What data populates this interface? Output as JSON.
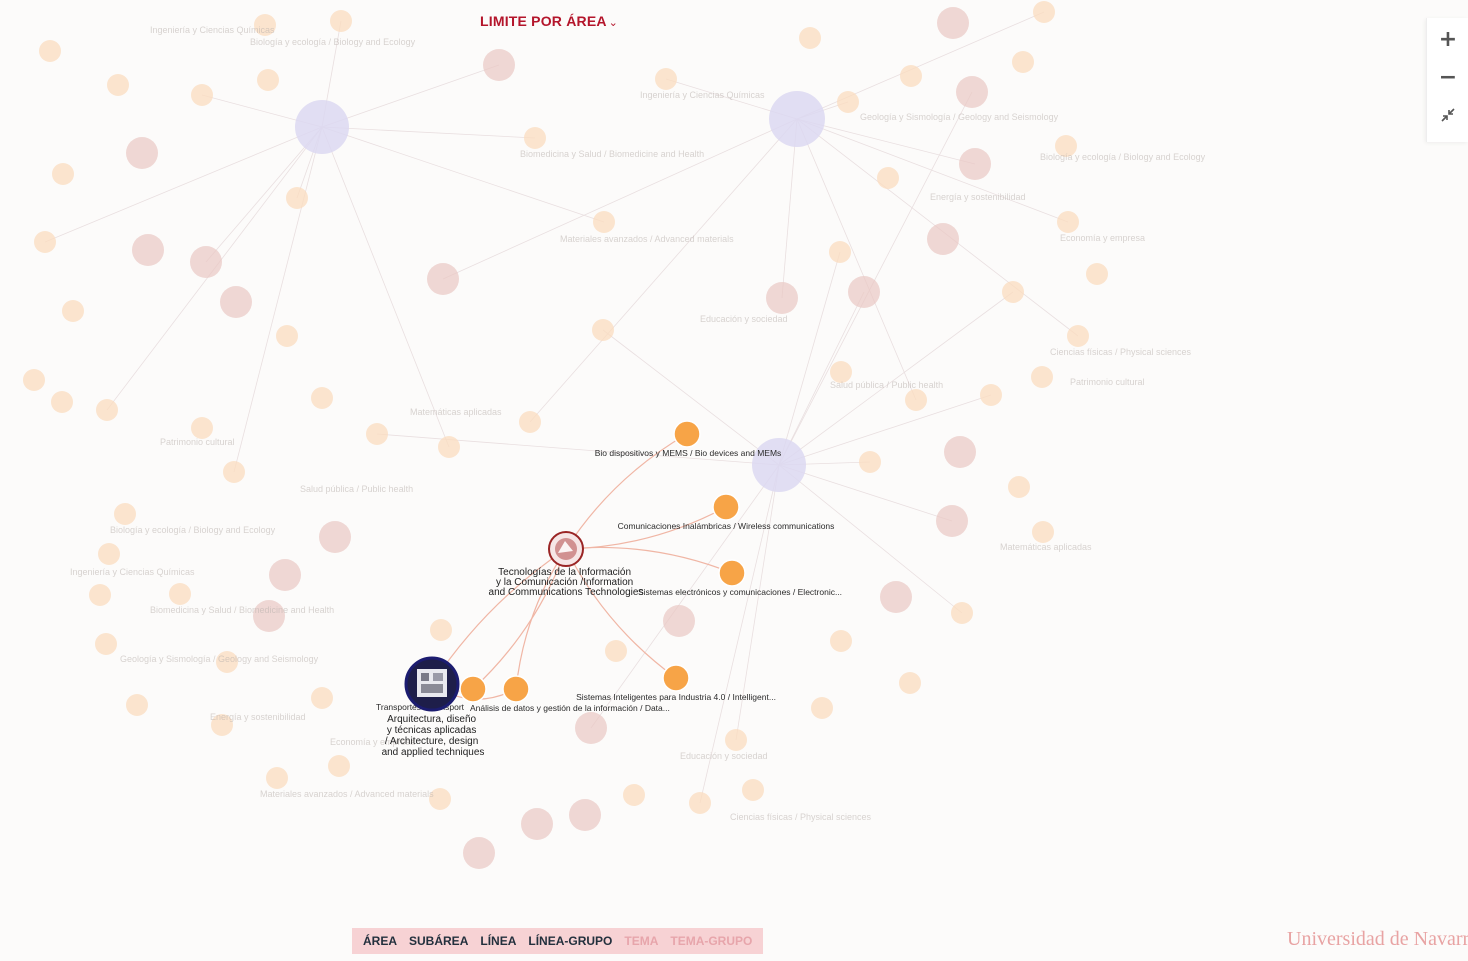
{
  "header": {
    "filter_label": "LIMITE POR ÁREA"
  },
  "zoom": {
    "in_label": "+",
    "out_label": "−"
  },
  "level_tabs": [
    {
      "label": "ÁREA",
      "active": true
    },
    {
      "label": "SUBÁREA",
      "active": true
    },
    {
      "label": "LÍNEA",
      "active": true
    },
    {
      "label": "LÍNEA-GRUPO",
      "active": true
    },
    {
      "label": "TEMA",
      "active": false
    },
    {
      "label": "TEMA-GRUPO",
      "active": false
    }
  ],
  "brand": "Universidad de Navarra",
  "graph": {
    "center_node": {
      "name": "center-node-tic",
      "lines": [
        "Tecnologías de la Información",
        "y la Comunicación /Information",
        "and Communications Technologies"
      ]
    },
    "related_area": {
      "name": "area-node-architecture",
      "lines": [
        "Arquitectura, diseño",
        "y técnicas aplicadas",
        "/ Architecture, design",
        "and applied techniques"
      ]
    },
    "connected_nodes": [
      {
        "name": "node-bio-devices",
        "label": "Bio dispositivos y MEMS / Bio devices and MEMs"
      },
      {
        "name": "node-wireless",
        "label": "Comunicaciones Inalámbricas / Wireless communications"
      },
      {
        "name": "node-electronic-systems",
        "label": "Sistemas electrónicos y comunicaciones / Electronic..."
      },
      {
        "name": "node-intelligent-systems",
        "label": "Sistemas Inteligentes para Industria 4.0 / Intelligent..."
      },
      {
        "name": "node-transport",
        "label": "Transportes / Transport"
      },
      {
        "name": "node-data",
        "label": "Análisis de datos y gestión de la información / Data..."
      }
    ],
    "faded_labels": [
      "Biología y ecología / Biology and Ecology",
      "Ingeniería y Ciencias Químicas",
      "Biomedicina y Salud / Biomedicine and Health",
      "Geología y Sismología / Geology and Seismology",
      "Energía y sostenibilidad",
      "Economía y empresa",
      "Materiales avanzados / Advanced materials",
      "Educación y sociedad",
      "Ciencias físicas / Physical sciences",
      "Matemáticas aplicadas",
      "Patrimonio cultural",
      "Salud pública / Public health"
    ]
  }
}
